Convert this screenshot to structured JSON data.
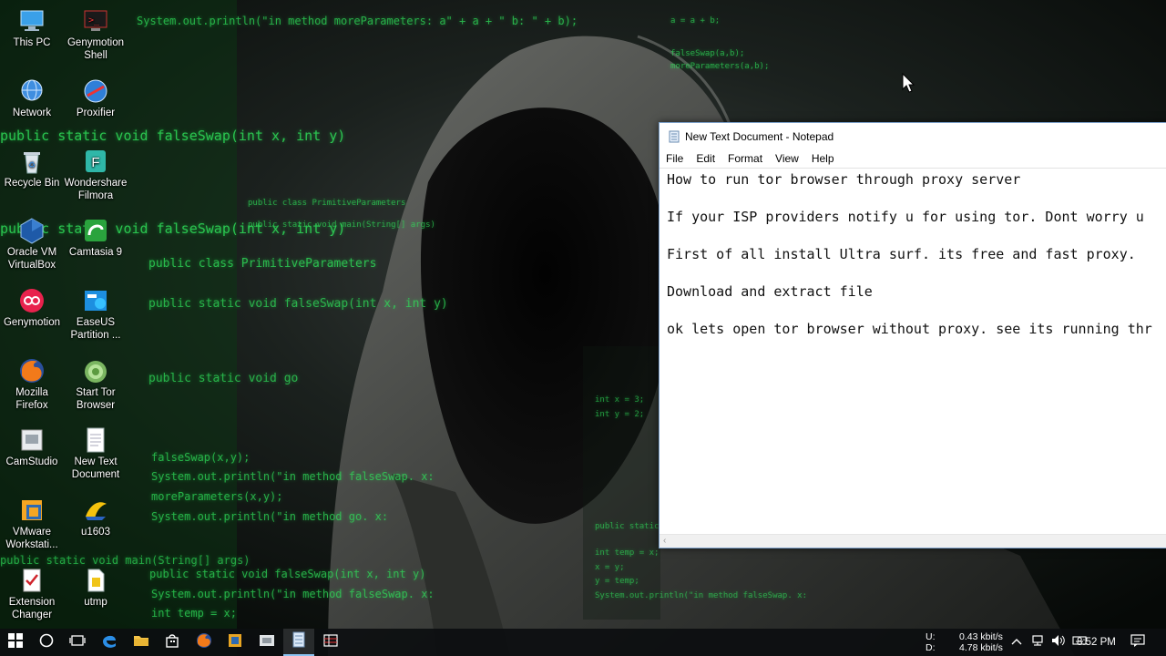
{
  "desktop": {
    "icons": [
      {
        "label": "This PC",
        "icon": "computer-icon"
      },
      {
        "label": "Genymotion Shell",
        "icon": "terminal-icon"
      },
      {
        "label": "Network",
        "icon": "network-icon"
      },
      {
        "label": "Proxifier",
        "icon": "proxifier-icon"
      },
      {
        "label": "Recycle Bin",
        "icon": "recycle-bin-icon"
      },
      {
        "label": "Wondershare Filmora",
        "icon": "filmora-icon"
      },
      {
        "label": "Oracle VM VirtualBox",
        "icon": "virtualbox-icon"
      },
      {
        "label": "Camtasia 9",
        "icon": "camtasia-icon"
      },
      {
        "label": "Genymotion",
        "icon": "genymotion-icon"
      },
      {
        "label": "EaseUS Partition ...",
        "icon": "easeus-icon"
      },
      {
        "label": "Mozilla Firefox",
        "icon": "firefox-icon"
      },
      {
        "label": "Start Tor Browser",
        "icon": "tor-browser-icon"
      },
      {
        "label": "CamStudio",
        "icon": "camstudio-icon"
      },
      {
        "label": "New Text Document",
        "icon": "text-document-icon"
      },
      {
        "label": "VMware Workstati...",
        "icon": "vmware-icon"
      },
      {
        "label": "u1603",
        "icon": "ultrasurf-icon"
      },
      {
        "label": "Extension Changer",
        "icon": "extension-changer-icon"
      },
      {
        "label": "utmp",
        "icon": "file-icon"
      }
    ]
  },
  "wallpaper": {
    "code_lines": [
      "System.out.println(\"in method moreParameters: a\" + a + \" b: \" + b);",
      "a = a + b;",
      "falseSwap(a,b);",
      "moreParameters(a,b);",
      "public class PrimitiveParameters",
      "public static void main(String[] args)",
      "public static void falseSwap(int x, int y)",
      "System.out.println(\"in method falseSwap. x:",
      "int temp = x;",
      "public static void go",
      "int x = 3;",
      "int y = 2;",
      "falseSwap(x,y);",
      "moreParameters(x,y);",
      "System.out.println(\"in method go. x:",
      "public static void main(String[] args)",
      "System.out.println(\"in method falseSwap. x:",
      "int temp = x;",
      "x = y;",
      "y = temp;"
    ]
  },
  "notepad": {
    "title": "New Text Document - Notepad",
    "menu": [
      "File",
      "Edit",
      "Format",
      "View",
      "Help"
    ],
    "lines": [
      "How to run tor browser through proxy server",
      "If your ISP providers notify u for using tor. Dont worry u",
      "First of all install Ultra surf. its free and fast proxy.",
      "Download and extract file",
      "ok lets open tor browser without proxy. see its running thr"
    ]
  },
  "taskbar": {
    "net_up": "U:",
    "net_down": "D:",
    "net_up_value": "0.43 kbit/s",
    "net_down_value": "4.78 kbit/s",
    "clock": "8:52 PM",
    "accent": "#8cc3f2"
  }
}
